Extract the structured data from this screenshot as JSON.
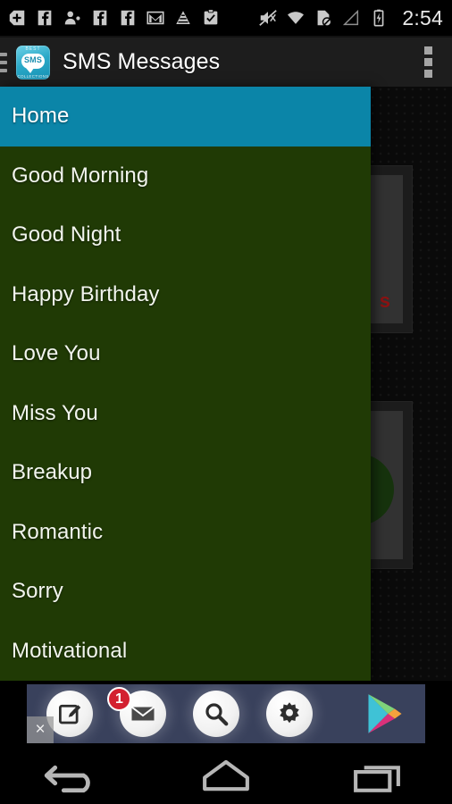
{
  "status_bar": {
    "time": "2:54",
    "left_icons": [
      {
        "name": "google-plus-icon"
      },
      {
        "name": "facebook-icon"
      },
      {
        "name": "contact-person-icon"
      },
      {
        "name": "facebook-icon"
      },
      {
        "name": "facebook-icon"
      },
      {
        "name": "gmail-icon"
      },
      {
        "name": "triangle-app-icon"
      },
      {
        "name": "clipboard-check-icon"
      }
    ],
    "right_icons": [
      {
        "name": "mute-volume-icon"
      },
      {
        "name": "wifi-icon"
      },
      {
        "name": "no-sim-card-icon"
      },
      {
        "name": "signal-strength-icon"
      },
      {
        "name": "battery-charging-icon"
      }
    ]
  },
  "action_bar": {
    "title": "SMS Messages",
    "drawer_toggle_label": "hamburger-menu",
    "app_icon": {
      "top_text": "BEST",
      "center_text": "SMS",
      "bottom_text": "COLLECTIONS"
    },
    "overflow_label": "more-options"
  },
  "nav_drawer": {
    "selected_index": 0,
    "items": [
      {
        "label": "Home"
      },
      {
        "label": "Good Morning"
      },
      {
        "label": "Good Night"
      },
      {
        "label": "Happy Birthday"
      },
      {
        "label": "Love You"
      },
      {
        "label": "Miss You"
      },
      {
        "label": "Breakup"
      },
      {
        "label": "Romantic"
      },
      {
        "label": "Sorry"
      },
      {
        "label": "Motivational"
      }
    ]
  },
  "ad_banner": {
    "close_label": "×",
    "badge_count": "1",
    "icons": [
      {
        "name": "compose-icon"
      },
      {
        "name": "mail-icon"
      },
      {
        "name": "search-icon"
      },
      {
        "name": "settings-gear-icon"
      },
      {
        "name": "google-play-icon"
      }
    ]
  },
  "system_nav": {
    "back_label": "back",
    "home_label": "home",
    "recents_label": "recent-apps"
  },
  "colors": {
    "drawer_background": "#203a05",
    "selected_item": "#0b85a8",
    "action_bar": "#1d1d1d",
    "ad_background": "#39415c",
    "badge_red": "#d32030"
  },
  "background_content": {
    "card_letter": "s"
  }
}
